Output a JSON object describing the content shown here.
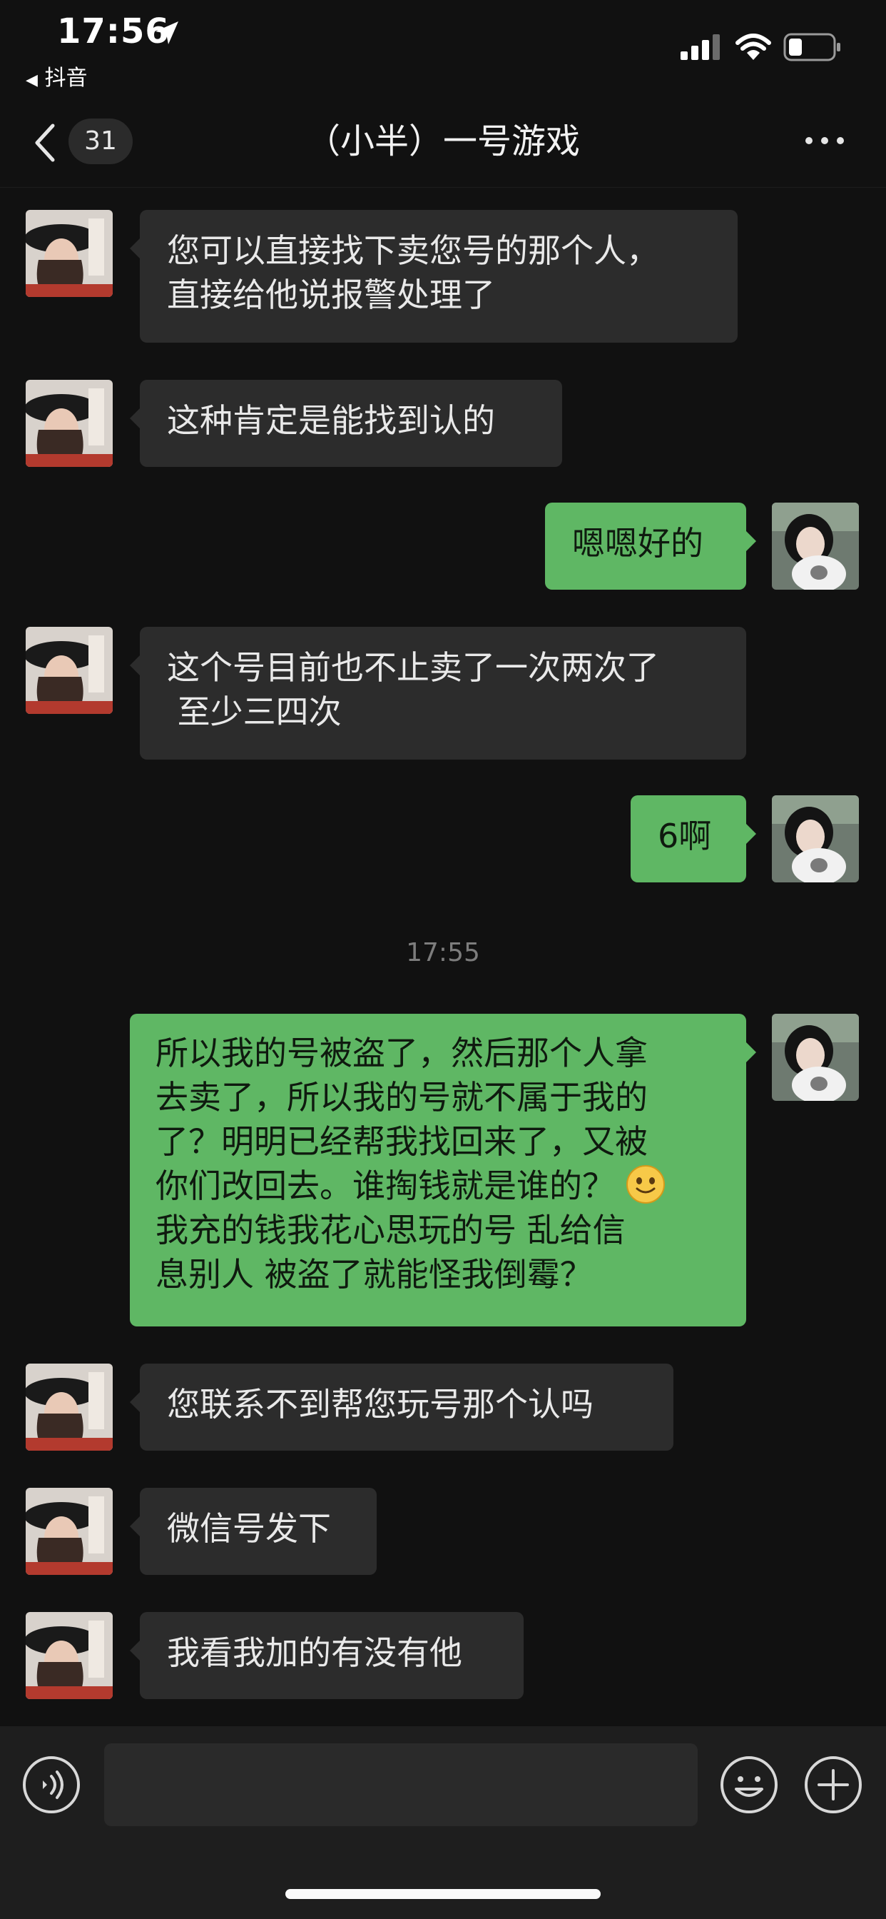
{
  "status_bar": {
    "time": "17:56",
    "back_app": "抖音",
    "icons": [
      "location-arrow-icon",
      "signal-icon",
      "wifi-icon",
      "battery-icon"
    ]
  },
  "header": {
    "unread_count": "31",
    "title": "（小半）一号游戏",
    "more_icon": "more-dots-icon",
    "back_icon": "chevron-left-icon"
  },
  "messages": [
    {
      "from": "other",
      "text_lines": [
        "您可以直接找下卖您号的那个人，",
        "直接给他说报警处理了"
      ]
    },
    {
      "from": "other",
      "text_lines": [
        "这种肯定是能找到认的"
      ]
    },
    {
      "from": "me",
      "text_lines": [
        "嗯嗯好的"
      ]
    },
    {
      "from": "other",
      "text_lines": [
        "这个号目前也不止卖了一次两次了",
        " 至少三四次"
      ]
    },
    {
      "from": "me",
      "text_lines": [
        "6啊"
      ]
    },
    {
      "timestamp": "17:55"
    },
    {
      "from": "me",
      "text_lines": [
        "所以我的号被盗了，然后那个人拿",
        "去卖了，所以我的号就不属于我的",
        "了？明明已经帮我找回来了，又被",
        "你们改回去。谁掏钱就是谁的？",
        "我充的钱我花心思玩的号 乱给信",
        "息别人 被盗了就能怪我倒霉？"
      ],
      "emoji": "smile-emoji-icon"
    },
    {
      "from": "other",
      "text_lines": [
        "您联系不到帮您玩号那个认吗"
      ]
    },
    {
      "from": "other",
      "text_lines": [
        "微信号发下"
      ]
    },
    {
      "from": "other",
      "text_lines": [
        "我看我加的有没有他"
      ]
    }
  ],
  "bottom_bar": {
    "voice_icon": "voice-icon",
    "emoji_icon": "emoji-face-icon",
    "add_icon": "plus-circle-icon"
  },
  "colors": {
    "background": "#111111",
    "incoming_bubble": "#2c2c2c",
    "outgoing_bubble": "#5fb764"
  }
}
